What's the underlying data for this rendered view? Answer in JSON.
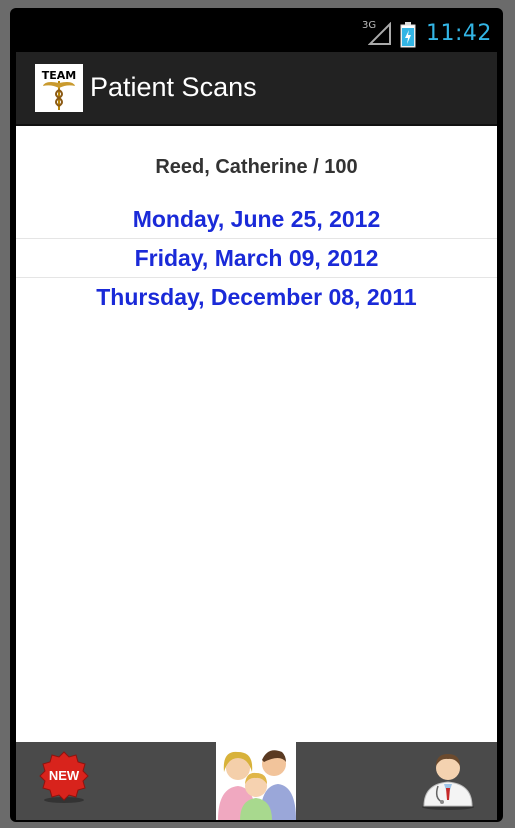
{
  "status_bar": {
    "network": "3G",
    "time": "11:42",
    "clock_color": "#33b5e5"
  },
  "action_bar": {
    "logo_text": "TEAM",
    "title": "Patient Scans"
  },
  "patient": {
    "label": "Reed, Catherine / 100"
  },
  "scans": [
    {
      "date": "Monday, June 25, 2012"
    },
    {
      "date": "Friday, March 09, 2012"
    },
    {
      "date": "Thursday, December 08, 2011"
    }
  ],
  "bottom_bar": {
    "new_label": "NEW",
    "new_icon": "new-badge-icon",
    "family_icon": "family-icon",
    "doctor_icon": "doctor-icon"
  },
  "colors": {
    "scan_link": "#1a2ad8",
    "new_badge": "#d8231c",
    "bottom_bar": "#4a4a4a"
  }
}
